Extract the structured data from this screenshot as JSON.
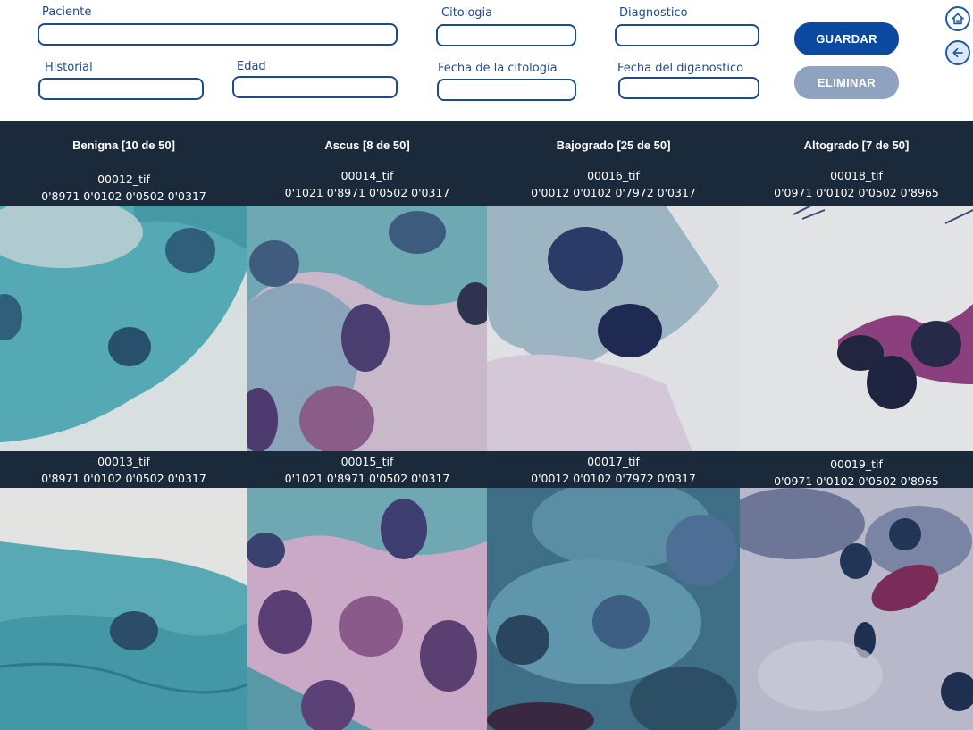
{
  "form": {
    "paciente_label": "Paciente",
    "paciente_value": "",
    "citologia_label": "Citologia",
    "citologia_value": "",
    "diagnostico_label": "Diagnostico",
    "diagnostico_value": "",
    "historial_label": "Historial",
    "historial_value": "",
    "edad_label": "Edad",
    "edad_value": "",
    "fecha_citologia_label": "Fecha de la citologia",
    "fecha_citologia_value": "",
    "fecha_diagnostico_label": "Fecha del diganostico",
    "fecha_diagnostico_value": ""
  },
  "buttons": {
    "save_label": "GUARDAR",
    "delete_label": "ELIMINAR"
  },
  "nav": {
    "home_icon": "home-icon",
    "back_icon": "arrow-left-icon"
  },
  "columns": [
    {
      "title": "Benigna [10 de 50]"
    },
    {
      "title": "Ascus [8 de 50]"
    },
    {
      "title": "Bajogrado [25 de 50]"
    },
    {
      "title": "Altogrado [7 de 50]"
    }
  ],
  "images": {
    "row1": [
      {
        "id": "00012_tif",
        "scores": "0'8971 0'0102 0'0502 0'0317"
      },
      {
        "id": "00014_tif",
        "scores": "0'1021 0'8971 0'0502 0'0317"
      },
      {
        "id": "00016_tif",
        "scores": "0'0012 0'0102 0'7972 0'0317"
      },
      {
        "id": "00018_tif",
        "scores": "0'0971 0'0102 0'0502 0'8965"
      }
    ],
    "row2": [
      {
        "id": "00013_tif",
        "scores": "0'8971 0'0102 0'0502 0'0317"
      },
      {
        "id": "00015_tif",
        "scores": "0'1021 0'8971 0'0502 0'0317"
      },
      {
        "id": "00017_tif",
        "scores": "0'0012 0'0102 0'7972 0'0317"
      },
      {
        "id": "00019_tif",
        "scores": "0'0971 0'0102 0'0502 0'8965"
      }
    ]
  },
  "colors": {
    "accent": "#0b4a9e",
    "label": "#1e4b8a",
    "panel": "#1b2a3a",
    "disabled": "#8fa2c0"
  }
}
